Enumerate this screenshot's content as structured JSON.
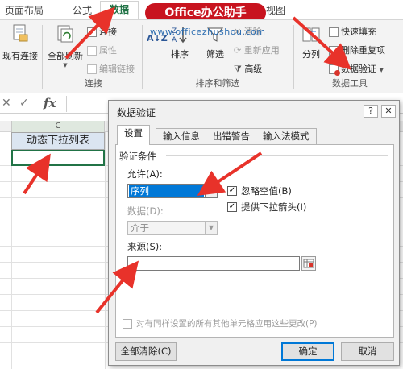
{
  "tabs": [
    {
      "label": "页面布局",
      "active": false
    },
    {
      "label": "公式",
      "active": false
    },
    {
      "label": "数据",
      "active": true
    },
    {
      "label": "视图",
      "active": false
    }
  ],
  "watermark": {
    "banner": "Office办公助手",
    "url": "www.officezhushou.com"
  },
  "ribbon": {
    "existing_conn": "现有连接",
    "refresh_all": "全部刷新",
    "conn": "连接",
    "props": "属性",
    "edit_links": "编辑链接",
    "group_conn": "连接",
    "sort_az": "A↓Z",
    "sort": "排序",
    "filter": "筛选",
    "clear": "清除",
    "reapply": "重新应用",
    "advanced": "高级",
    "group_sort": "排序和筛选",
    "split": "分列",
    "flash_fill": "快速填充",
    "remove_dup": "删除重复项",
    "data_valid": "数据验证",
    "group_tools": "数据工具"
  },
  "formula_bar": {
    "cancel": "✕",
    "enter": "✓",
    "fx": "fx"
  },
  "sheet": {
    "col_c": "C",
    "cell_c1": "动态下拉列表"
  },
  "dialog": {
    "title": "数据验证",
    "help": "?",
    "close": "✕",
    "tabs": [
      {
        "label": "设置",
        "active": true
      },
      {
        "label": "输入信息",
        "active": false
      },
      {
        "label": "出错警告",
        "active": false
      },
      {
        "label": "输入法模式",
        "active": false
      }
    ],
    "section": "验证条件",
    "allow_label": "允许(A):",
    "allow_value": "序列",
    "ignore_blank": "忽略空值(B)",
    "ignore_blank_checked": true,
    "dropdown": "提供下拉箭头(I)",
    "dropdown_checked": true,
    "data_label": "数据(D):",
    "data_value": "介于",
    "source_label": "来源(S):",
    "source_value": "",
    "apply_all": "对有同样设置的所有其他单元格应用这些更改(P)",
    "apply_all_checked": false,
    "clear_all": "全部清除(C)",
    "ok": "确定",
    "cancel": "取消"
  },
  "colors": {
    "excel_green": "#217346",
    "watermark_red": "#c8141f",
    "arrow_red": "#e8322a",
    "selection_blue": "#0078d7"
  }
}
